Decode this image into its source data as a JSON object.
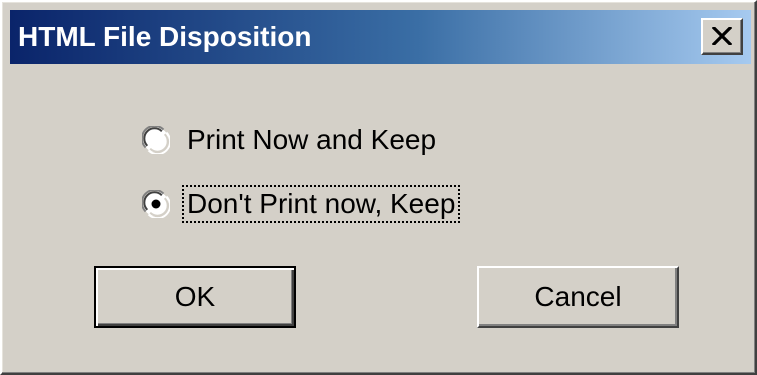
{
  "window": {
    "title": "HTML File Disposition",
    "close_glyph": "✕",
    "titlebar_colors": [
      "#0a246a",
      "#a6caf0"
    ],
    "background": "#d4d0c8"
  },
  "options": [
    {
      "label": "Print Now and Keep",
      "selected": false,
      "focused": false
    },
    {
      "label": "Don't Print now, Keep",
      "selected": true,
      "focused": true
    }
  ],
  "buttons": {
    "ok_label": "OK",
    "cancel_label": "Cancel",
    "default_button": "OK"
  }
}
